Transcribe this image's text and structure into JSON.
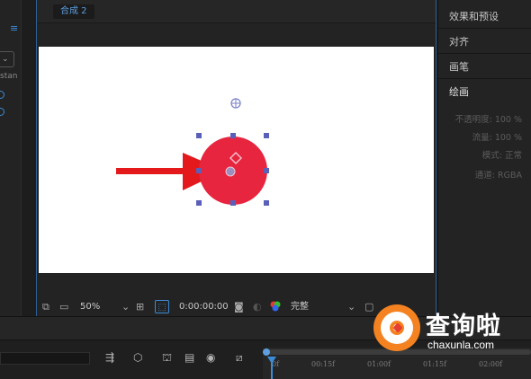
{
  "comp_panel": {
    "tab_label": "合成 2",
    "toolbar": {
      "zoom": "50%",
      "timecode": "0:00:00:00",
      "resolution": "完整"
    }
  },
  "left_panel": {
    "partial_text": "stan"
  },
  "right_panel": {
    "items": [
      "效果和预设",
      "对齐",
      "画笔",
      "绘画"
    ],
    "paint_props": [
      {
        "label": "不透明度:",
        "value": "100 %"
      },
      {
        "label": "流量:",
        "value": "100 %"
      },
      {
        "label": "模式:",
        "value": "正常"
      },
      {
        "label": "通道:",
        "value": "RGBA"
      }
    ]
  },
  "timeline": {
    "ticks": [
      "0f",
      "00:15f",
      "01:00f",
      "01:15f",
      "02:00f"
    ]
  },
  "watermark": {
    "title": "查询啦",
    "url": "chaxunla.com"
  },
  "colors": {
    "accent_blue": "#3c8bd6",
    "shape_red": "#e8253f",
    "arrow_red": "#e3191c",
    "handle_blue": "#5a5fb8",
    "watermark_orange": "#f58220"
  },
  "icons": [
    "snapshot-icon",
    "monitor-icon",
    "chevron-down-icon",
    "grid-icon",
    "mask-icon",
    "camera-icon",
    "color-channels-icon",
    "flowchart-icon",
    "3d-icon",
    "motion-blur-icon",
    "graph-editor-icon"
  ]
}
